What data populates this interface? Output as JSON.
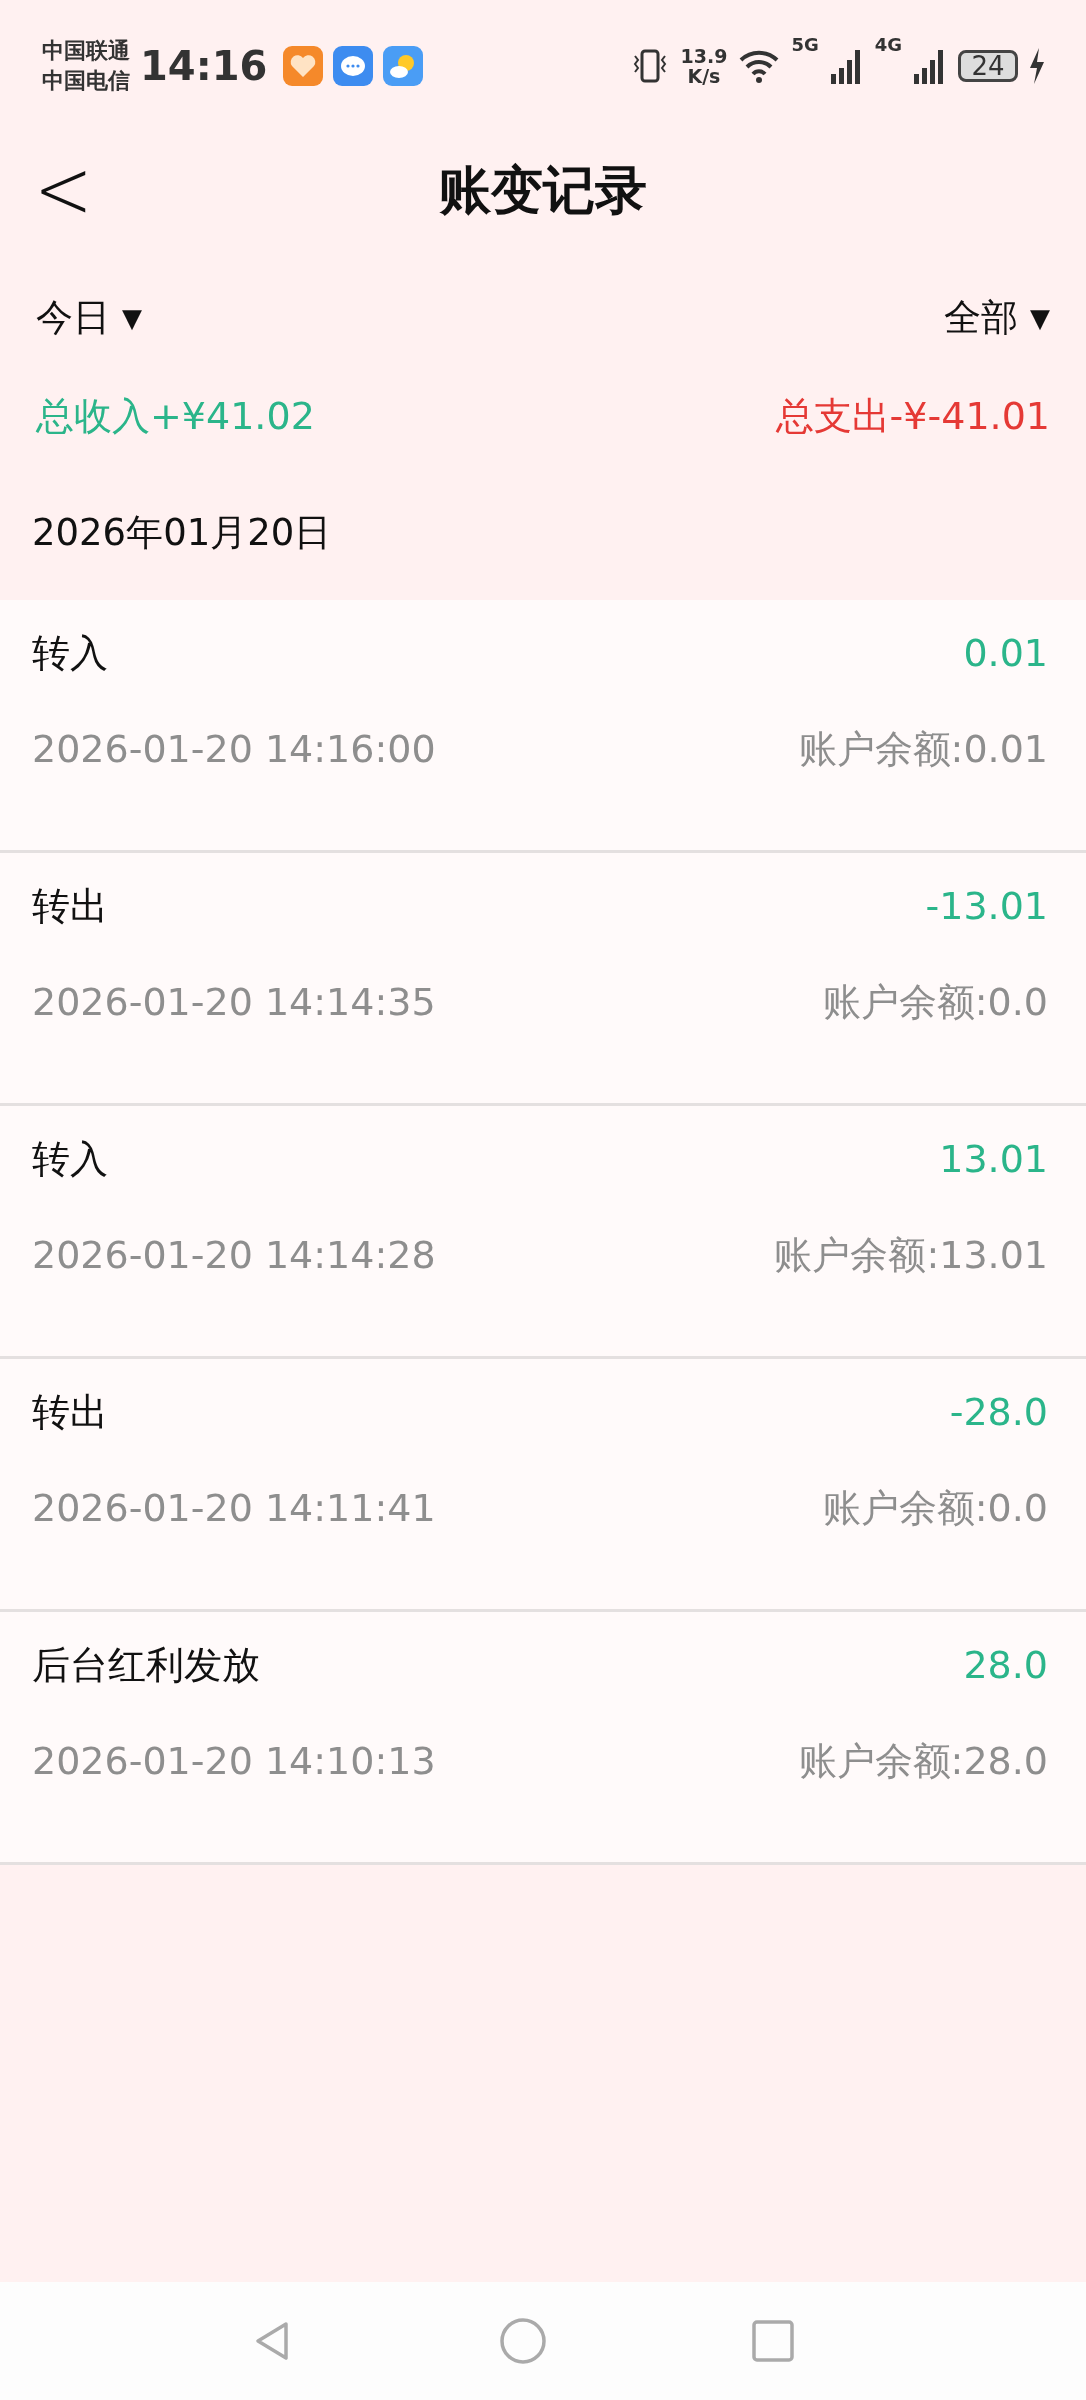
{
  "status_bar": {
    "carriers": [
      "中国联通",
      "中国电信"
    ],
    "time": "14:16",
    "speed": [
      "13.9",
      "K/s"
    ],
    "network_1": "5G",
    "network_2": "4G",
    "battery": "24"
  },
  "header": {
    "back": "<",
    "title": "账变记录"
  },
  "filters": [
    {
      "label": "今日",
      "caret": "▼"
    },
    {
      "label": "全部",
      "caret": "▼"
    }
  ],
  "totals": [
    {
      "kind": "income",
      "text": "总收入+¥41.02"
    },
    {
      "kind": "expense",
      "text": "总支出-¥-41.01"
    }
  ],
  "date": "2026年01月20日",
  "records": [
    {
      "title": "转入",
      "amount": "0.01",
      "time": "2026-01-20 14:16:00",
      "balance": "账户余额:0.01"
    },
    {
      "title": "转出",
      "amount": "-13.01",
      "time": "2026-01-20 14:14:35",
      "balance": "账户余额:0.0"
    },
    {
      "title": "转入",
      "amount": "13.01",
      "time": "2026-01-20 14:14:28",
      "balance": "账户余额:13.01"
    },
    {
      "title": "转出",
      "amount": "-28.0",
      "time": "2026-01-20 14:11:41",
      "balance": "账户余额:0.0"
    },
    {
      "title": "后台红利发放",
      "amount": "28.0",
      "time": "2026-01-20 14:10:13",
      "balance": "账户余额:28.0"
    }
  ]
}
